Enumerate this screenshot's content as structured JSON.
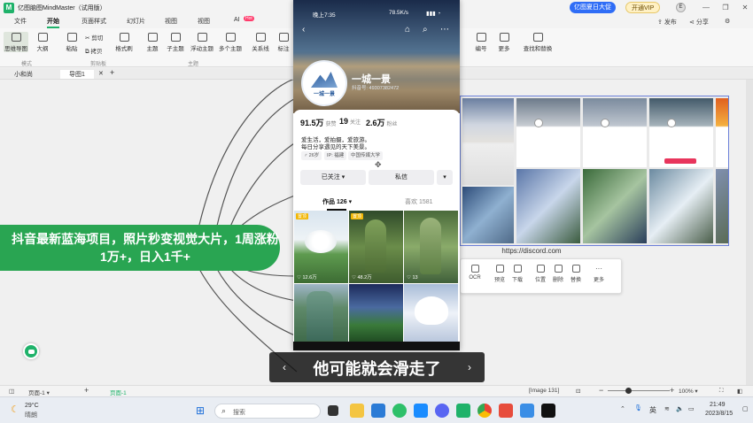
{
  "app": {
    "title": "亿图脑图MindMaster（试用版）",
    "promo": "亿图夏日大促",
    "vip": "开通VIP",
    "avatar": "E",
    "publish": "发布",
    "share": "分享"
  },
  "menu": {
    "file": "文件",
    "start": "开始",
    "page_style": "页面样式",
    "slides": "幻灯片",
    "view_mode": "视图",
    "view": "视图",
    "ai": "AI",
    "ai_badge": "Hot"
  },
  "ribbon": {
    "mindmap": "思维导图",
    "outline": "大纲",
    "paste": "粘贴",
    "cut": "剪切",
    "copy": "拷贝",
    "format_brush": "格式刷",
    "topic": "主题",
    "subtopic": "子主题",
    "float_topic": "浮动主题",
    "multi_topic": "多个主题",
    "relation": "关系线",
    "label": "标注",
    "number": "编号",
    "more": "更多",
    "find_replace": "查找和替换",
    "group_mode": "模式",
    "group_clipboard": "剪贴板",
    "group_topic": "主题"
  },
  "doc_tabs": {
    "home": "小和尚",
    "doc": "导图1"
  },
  "canvas": {
    "main_topic": "抖音最新蓝海项目，照片秒变视觉大片，1周涨粉1万+，日入1千+",
    "url": "https://discord.com"
  },
  "phone": {
    "time": "晚上7:35",
    "net": "78.5K/s",
    "name": "一城一景",
    "id": "抖音号: 49307382472",
    "avatar_text": "一城一景",
    "likes_num": "91.5万",
    "likes_lbl": "获赞",
    "follow_num": "19",
    "follow_lbl": "关注",
    "fans_num": "2.6万",
    "fans_lbl": "粉丝",
    "bio1": "爱生活，爱拍摄，爱旅游。",
    "bio2": "每日分享遇见的天下美景。",
    "tag_age": "26岁",
    "tag_ip": "IP: 福建",
    "tag_school": "中国传媒大学",
    "btn_followed": "已关注 ▾",
    "btn_message": "私信",
    "btn_more": "▾",
    "tab_works": "作品 126 ▾",
    "tab_likes": "喜欢 1581",
    "thumbs": [
      {
        "badge": "置顶",
        "likes": "12.6万"
      },
      {
        "badge": "置顶",
        "likes": "48.2万"
      },
      {
        "badge": "",
        "likes": "13"
      },
      {
        "badge": "",
        "likes": ""
      },
      {
        "badge": "",
        "likes": ""
      },
      {
        "badge": "",
        "likes": ""
      }
    ]
  },
  "context_bar": {
    "ocr": "OCR",
    "preview": "预览",
    "download": "下载",
    "position": "位置",
    "delete": "删除",
    "replace": "替换",
    "more": "更多"
  },
  "subtitle": "他可能就会滑走了",
  "statusbar": {
    "page": "页面-1",
    "page_active": "页面-1",
    "image_info": "[Image 131]",
    "zoom": "100%"
  },
  "taskbar": {
    "weather_temp": "29°C",
    "weather_desc": "晴朗",
    "search_placeholder": "搜索",
    "ime": "英",
    "time": "21:49",
    "date": "2023/8/15"
  },
  "colors": {
    "accent": "#1fb26a",
    "main_topic": "#29a552",
    "promo": "#2f6df6"
  }
}
